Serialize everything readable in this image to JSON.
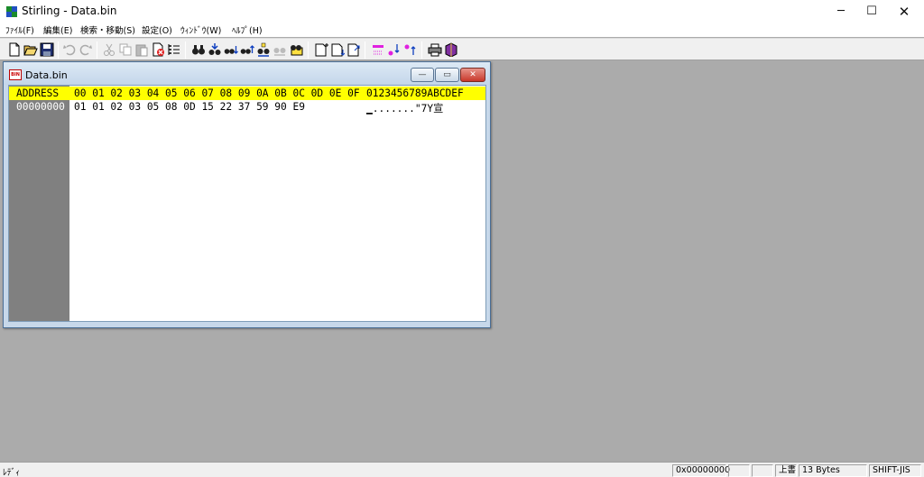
{
  "window": {
    "title": "Stirling - Data.bin"
  },
  "window_controls": {
    "minimize": "─",
    "maximize": "☐",
    "close": "✕"
  },
  "menu": [
    {
      "label": "ﾌｧｲﾙ(F)"
    },
    {
      "label": "編集(E)"
    },
    {
      "label": "検索・移動(S)"
    },
    {
      "label": "設定(O)"
    },
    {
      "label": "ｳｨﾝﾄﾞｳ(W)"
    },
    {
      "label": "ﾍﾙﾌﾟ(H)"
    }
  ],
  "toolbar": [
    {
      "icon": "new-file-icon"
    },
    {
      "icon": "open-folder-icon"
    },
    {
      "icon": "save-icon"
    },
    {
      "icon": "undo-icon"
    },
    {
      "icon": "redo-icon"
    },
    {
      "icon": "cut-icon"
    },
    {
      "icon": "copy-icon"
    },
    {
      "icon": "paste-icon"
    },
    {
      "icon": "delete-icon"
    },
    {
      "icon": "insert-icon"
    },
    {
      "icon": "find-icon"
    },
    {
      "icon": "find-next-icon"
    },
    {
      "icon": "find-down-icon"
    },
    {
      "icon": "find-up-icon"
    },
    {
      "icon": "replace-icon"
    },
    {
      "icon": "replace-all-icon"
    },
    {
      "icon": "goto-icon"
    },
    {
      "icon": "page-next-icon"
    },
    {
      "icon": "page-down-icon"
    },
    {
      "icon": "page-jump-icon"
    },
    {
      "icon": "mark-icon"
    },
    {
      "icon": "mark-down-icon"
    },
    {
      "icon": "mark-up-icon"
    },
    {
      "icon": "print-icon"
    },
    {
      "icon": "help-book-icon"
    }
  ],
  "child_window": {
    "title": "Data.bin",
    "icon_text": "BIN",
    "controls": {
      "minimize": "—",
      "maximize": "▭",
      "close": "✕"
    },
    "header": {
      "address": "ADDRESS",
      "hex": "00 01 02 03 04 05 06 07 08 09 0A 0B 0C 0D 0E 0F",
      "ascii": "0123456789ABCDEF"
    },
    "rows": [
      {
        "address": "00000000",
        "hex": "01 01 02 03 05 08 0D 15 22 37 59 90 E9",
        "ascii": "▁.......\"7Y宣"
      }
    ],
    "colors": {
      "header_bg": "#ffff00",
      "address_bg": "#808080"
    }
  },
  "status": {
    "text": "ﾚﾃﾞｨ",
    "offset": "0x00000000",
    "mode": "上書",
    "size": "13 Bytes",
    "encoding": "SHIFT-JIS"
  }
}
